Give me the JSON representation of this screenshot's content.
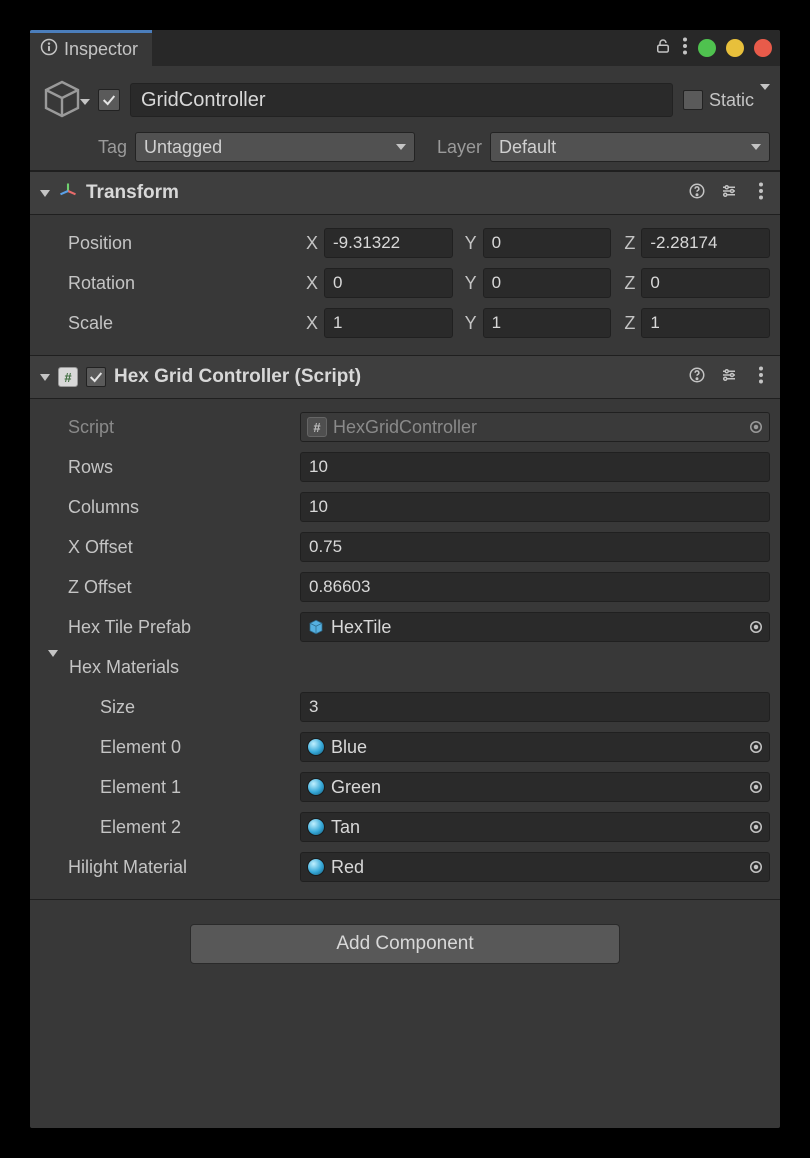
{
  "tab": {
    "title": "Inspector"
  },
  "traffic": {
    "green": "#4fc24f",
    "yellow": "#e8c03b",
    "red": "#e85b4a"
  },
  "gameObject": {
    "name": "GridController",
    "enabled": true,
    "static_label": "Static",
    "tag_label": "Tag",
    "tag_value": "Untagged",
    "layer_label": "Layer",
    "layer_value": "Default"
  },
  "transform": {
    "title": "Transform",
    "position_label": "Position",
    "rotation_label": "Rotation",
    "scale_label": "Scale",
    "axis_x": "X",
    "axis_y": "Y",
    "axis_z": "Z",
    "position": {
      "x": "-9.31322",
      "y": "0",
      "z": "-2.28174"
    },
    "rotation": {
      "x": "0",
      "y": "0",
      "z": "0"
    },
    "scale": {
      "x": "1",
      "y": "1",
      "z": "1"
    }
  },
  "hexGrid": {
    "title": "Hex Grid Controller (Script)",
    "script_label": "Script",
    "script_value": "HexGridController",
    "rows_label": "Rows",
    "rows_value": "10",
    "columns_label": "Columns",
    "columns_value": "10",
    "xoffset_label": "X Offset",
    "xoffset_value": "0.75",
    "zoffset_label": "Z Offset",
    "zoffset_value": "0.86603",
    "prefab_label": "Hex Tile Prefab",
    "prefab_value": "HexTile",
    "materials_label": "Hex Materials",
    "size_label": "Size",
    "size_value": "3",
    "elem0_label": "Element 0",
    "elem0_value": "Blue",
    "elem1_label": "Element 1",
    "elem1_value": "Green",
    "elem2_label": "Element 2",
    "elem2_value": "Tan",
    "hilight_label": "Hilight Material",
    "hilight_value": "Red"
  },
  "addComponent": {
    "label": "Add Component"
  }
}
